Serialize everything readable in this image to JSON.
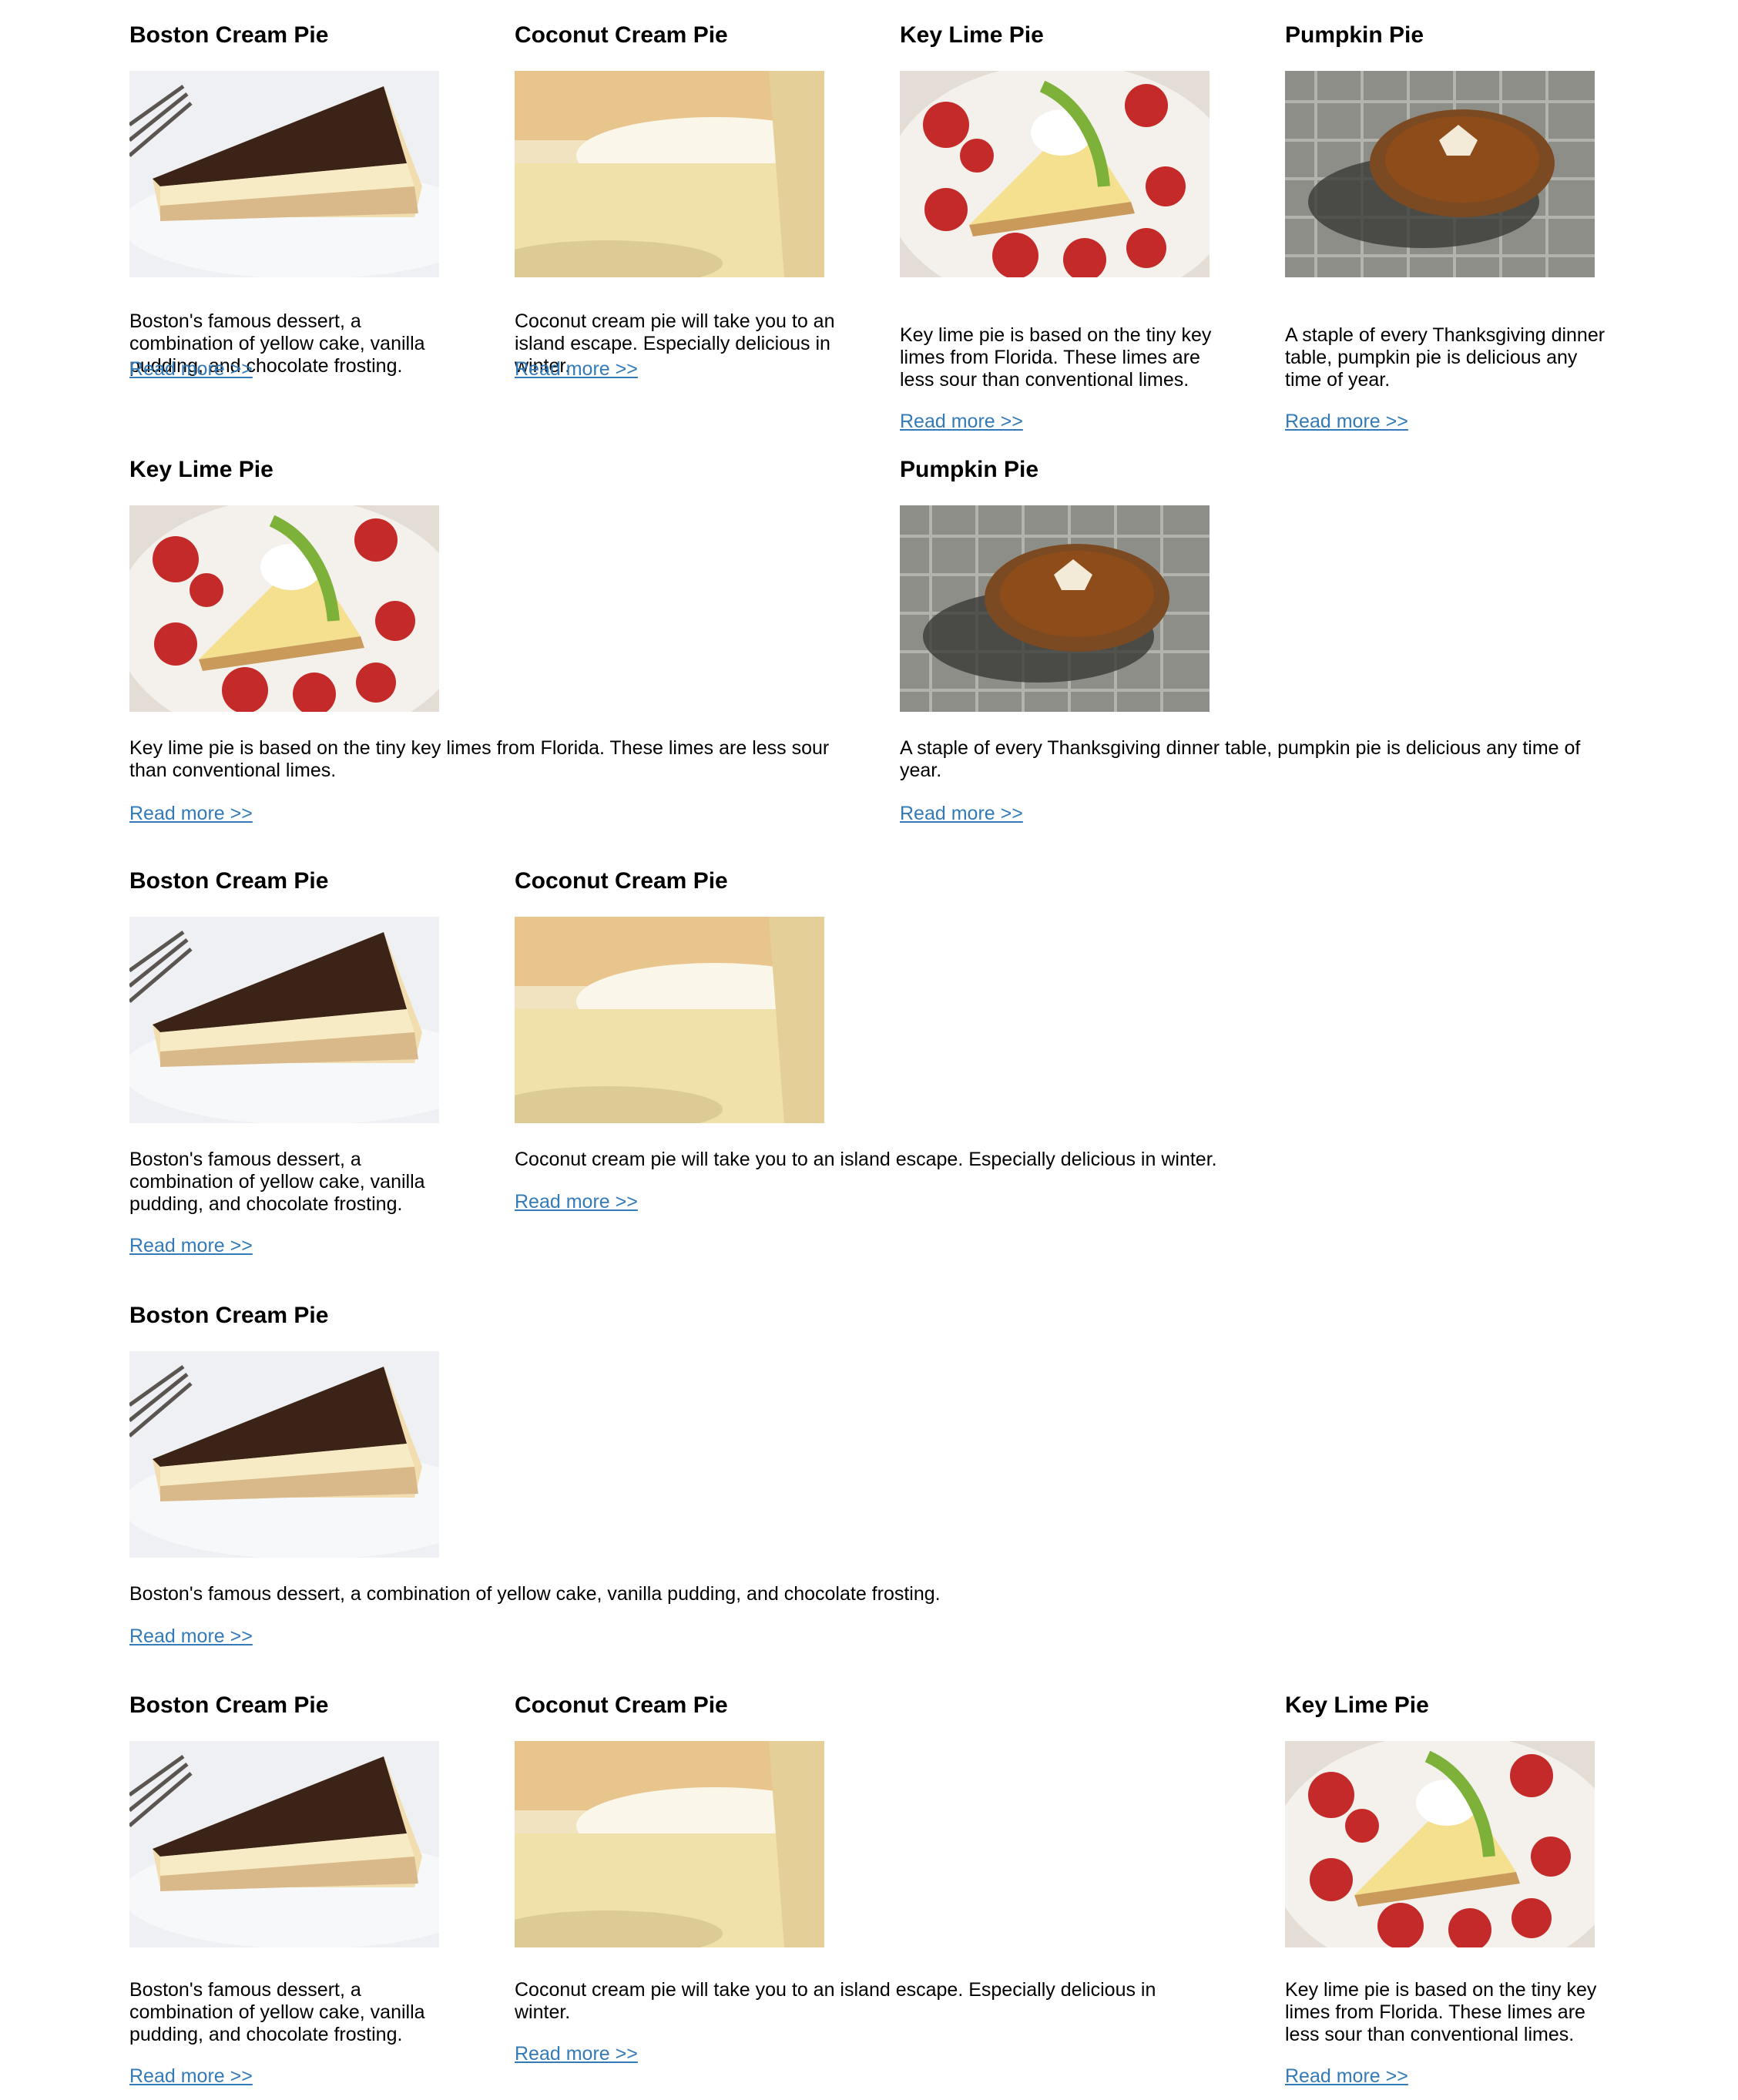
{
  "read_more": "Read more >>",
  "pies": {
    "boston": {
      "title": "Boston Cream Pie",
      "desc": "Boston's famous dessert, a combination of yellow cake, vanilla pudding, and chocolate frosting."
    },
    "coconut": {
      "title": "Coconut Cream Pie",
      "desc": "Coconut cream pie will take you to an island escape. Especially delicious in winter."
    },
    "keylime": {
      "title": "Key Lime Pie",
      "desc": "Key lime pie is based on the tiny key limes from Florida. These limes are less sour than conventional limes."
    },
    "pumpkin": {
      "title": "Pumpkin Pie",
      "desc": "A staple of every Thanksgiving dinner table, pumpkin pie is delicious any time of year."
    }
  }
}
